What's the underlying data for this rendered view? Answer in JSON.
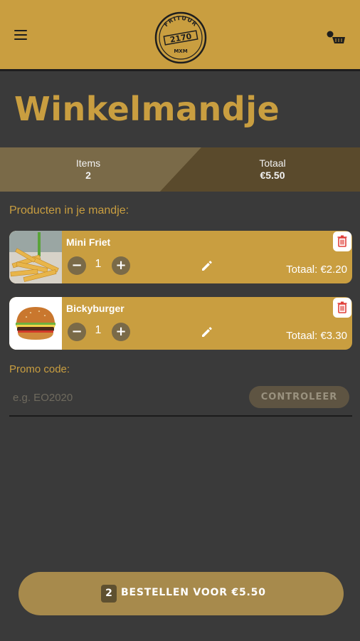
{
  "header": {
    "menu_icon": "hamburger-icon",
    "logo_text_top": "FRITUUR",
    "logo_text_mid": "2170",
    "logo_text_bottom": "MXM",
    "cart_icon": "cart-icon"
  },
  "page": {
    "title": "Winkelmandje"
  },
  "summary": {
    "items_label": "Items",
    "items_value": "2",
    "total_label": "Totaal",
    "total_value": "€5.50"
  },
  "cart": {
    "section_label": "Producten in je mandje:",
    "items": [
      {
        "name": "Mini Friet",
        "quantity": "1",
        "minus": "−",
        "plus": "+",
        "total": "Totaal: €2.20",
        "image": "fries-photo"
      },
      {
        "name": "Bickyburger",
        "quantity": "1",
        "minus": "−",
        "plus": "+",
        "total": "Totaal: €3.30",
        "image": "burger-photo"
      }
    ]
  },
  "promo": {
    "label": "Promo code:",
    "placeholder": "e.g. EO2020",
    "button": "CONTROLEER"
  },
  "order": {
    "count": "2",
    "label": "BESTELLEN VOOR €5.50"
  },
  "colors": {
    "accent": "#c99e40",
    "background": "#3a3a3a",
    "order_button": "#a78a4c"
  }
}
